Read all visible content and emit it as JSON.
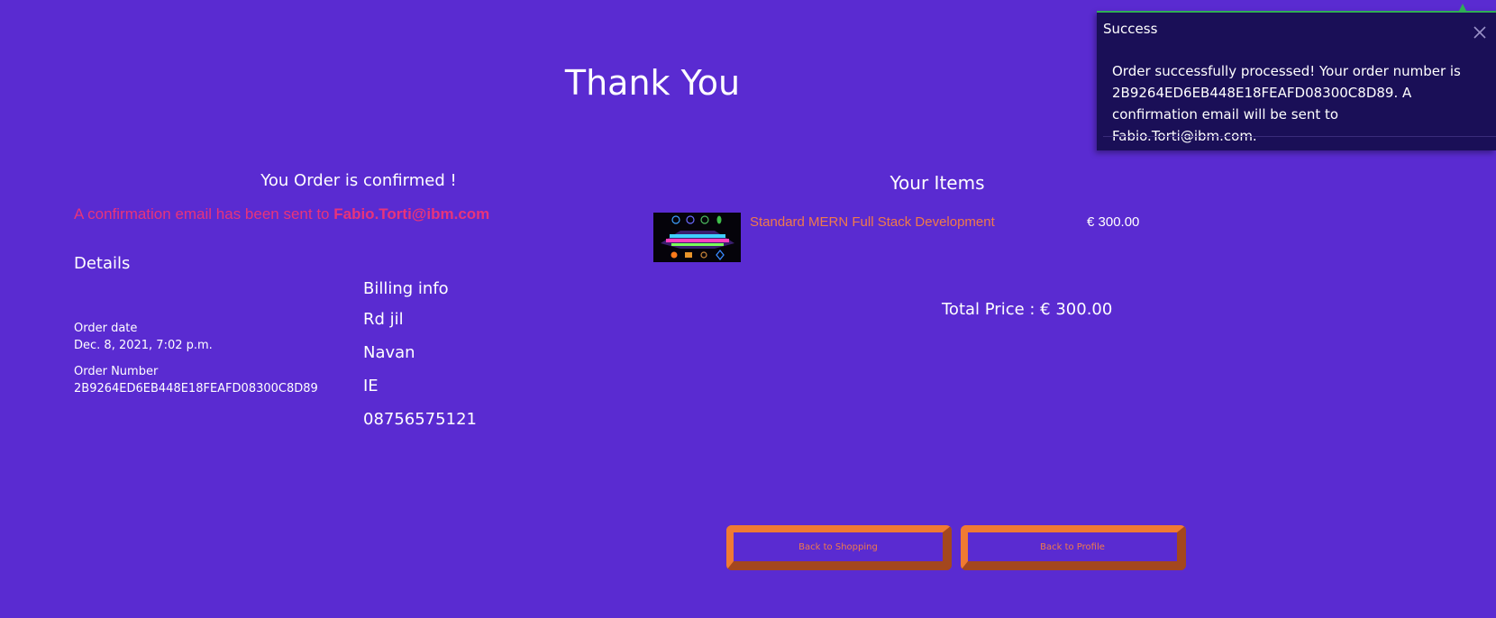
{
  "page": {
    "title": "Thank You"
  },
  "confirmation": {
    "heading": "You Order is confirmed !",
    "email_prefix": "A confirmation email has been sent to",
    "email": "Fabio.Torti@ibm.com"
  },
  "details": {
    "heading": "Details",
    "order_date_label": "Order date",
    "order_date_value": "Dec. 8, 2021, 7:02 p.m.",
    "order_number_label": "Order Number",
    "order_number_value": "2B9264ED6EB448E18FEAFD08300C8D89"
  },
  "billing": {
    "heading": "Billing info",
    "lines": [
      "Rd jil",
      "Navan",
      "IE",
      "08756575121"
    ]
  },
  "items": {
    "heading": "Your Items",
    "list": [
      {
        "name": "Standard MERN Full Stack Development",
        "price": "€ 300.00",
        "thumbnail_icon": "mern-stack-thumbnail"
      }
    ],
    "total": "Total Price : € 300.00"
  },
  "buttons": {
    "shopping": "Back to Shopping",
    "profile": "Back to Profile"
  },
  "toast": {
    "title": "Success",
    "message": "Order successfully processed! Your order number is 2B9264ED6EB448E18FEAFD08300C8D89. A confirmation email will be sent to Fabio.Torti@ibm.com.",
    "close_icon": "close-icon"
  },
  "colors": {
    "background": "#5a2bd1",
    "email_text": "#e8347a",
    "item_link": "#f07a4a",
    "button_border": "#f07a32",
    "toast_background": "#1a0f57",
    "toast_accent": "#2fae55"
  }
}
